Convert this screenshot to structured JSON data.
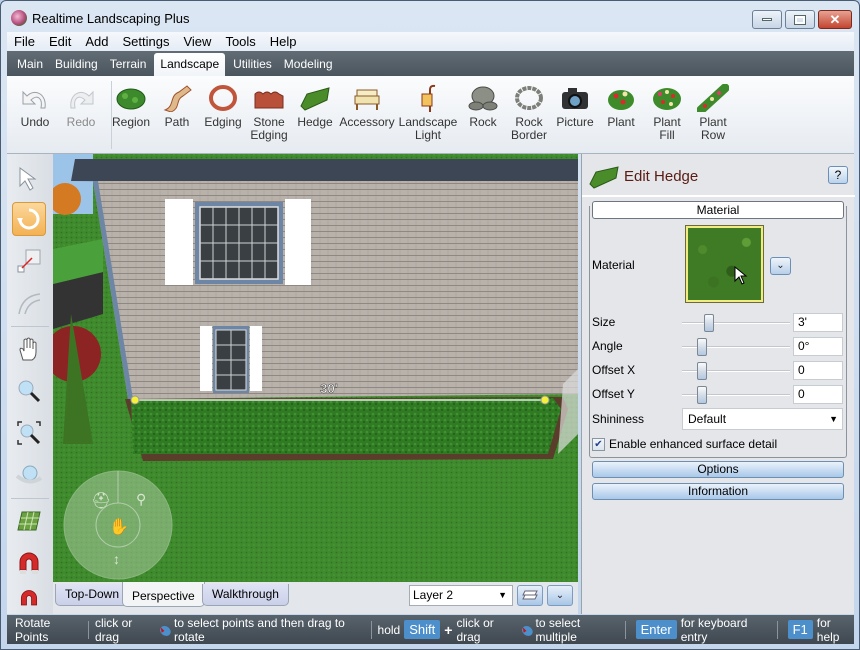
{
  "window": {
    "title": "Realtime Landscaping Plus",
    "controls": {
      "minimize": "minimize",
      "maximize": "maximize",
      "close": "close"
    }
  },
  "menu": [
    "File",
    "Edit",
    "Add",
    "Settings",
    "View",
    "Tools",
    "Help"
  ],
  "tabs": [
    {
      "label": "Main",
      "active": false
    },
    {
      "label": "Building",
      "active": false
    },
    {
      "label": "Terrain",
      "active": false
    },
    {
      "label": "Landscape",
      "active": true
    },
    {
      "label": "Utilities",
      "active": false
    },
    {
      "label": "Modeling",
      "active": false
    }
  ],
  "ribbon": {
    "undo": {
      "label": "Undo",
      "icon": "undo-icon"
    },
    "redo": {
      "label": "Redo",
      "icon": "redo-icon",
      "disabled": true
    },
    "items": [
      {
        "label": "Region",
        "icon": "region-icon"
      },
      {
        "label": "Path",
        "icon": "path-icon"
      },
      {
        "label": "Edging",
        "icon": "edging-icon"
      },
      {
        "label": "Stone Edging",
        "icon": "stone-edging-icon"
      },
      {
        "label": "Hedge",
        "icon": "hedge-icon"
      },
      {
        "label": "Accessory",
        "icon": "accessory-icon"
      },
      {
        "label": "Landscape Light",
        "icon": "landscape-light-icon"
      },
      {
        "label": "Rock",
        "icon": "rock-icon"
      },
      {
        "label": "Rock Border",
        "icon": "rock-border-icon"
      },
      {
        "label": "Picture",
        "icon": "camera-icon"
      },
      {
        "label": "Plant",
        "icon": "plant-icon"
      },
      {
        "label": "Plant Fill",
        "icon": "plant-fill-icon"
      },
      {
        "label": "Plant Row",
        "icon": "plant-row-icon"
      }
    ]
  },
  "left_tools": [
    {
      "name": "select",
      "icon": "arrow-pointer-icon",
      "active": false
    },
    {
      "name": "rotate-points",
      "icon": "rotate-icon",
      "active": true
    },
    {
      "name": "resize",
      "icon": "resize-icon",
      "active": false
    },
    {
      "name": "curve",
      "icon": "curve-icon",
      "active": false,
      "disabled": true
    },
    {
      "name": "pan",
      "icon": "hand-icon",
      "active": false
    },
    {
      "name": "zoom",
      "icon": "magnifier-icon",
      "active": false
    },
    {
      "name": "zoom-extents",
      "icon": "zoom-extents-icon",
      "active": false
    },
    {
      "name": "orbit",
      "icon": "orbit-icon",
      "active": false
    },
    {
      "name": "grid",
      "icon": "grid-icon",
      "active": false
    },
    {
      "name": "snap",
      "icon": "magnet-icon",
      "active": false
    },
    {
      "name": "snap-objects",
      "icon": "magnet-small-icon",
      "active": false
    }
  ],
  "viewport": {
    "measurement": "30'",
    "nav_widget": [
      "orbit-icon",
      "zoom-icon",
      "pan-icon",
      "elevate-icon"
    ]
  },
  "view_tabs": [
    {
      "label": "Top-Down",
      "active": false
    },
    {
      "label": "Perspective",
      "active": true
    },
    {
      "label": "Walkthrough",
      "active": false
    }
  ],
  "layer": {
    "selected": "Layer 2"
  },
  "panel": {
    "title": "Edit Hedge",
    "help": "?",
    "group_title": "Material",
    "material_label": "Material",
    "fields": [
      {
        "label": "Size",
        "value": "3'",
        "slider": 0.22
      },
      {
        "label": "Angle",
        "value": "0°",
        "slider": 0.15
      },
      {
        "label": "Offset X",
        "value": "0",
        "slider": 0.15
      },
      {
        "label": "Offset Y",
        "value": "0",
        "slider": 0.15
      }
    ],
    "shininess": {
      "label": "Shininess",
      "value": "Default"
    },
    "enhanced_detail": {
      "label": "Enable enhanced surface detail",
      "checked": true
    },
    "options_label": "Options",
    "information_label": "Information"
  },
  "status": {
    "mode": "Rotate Points",
    "hint1_a": "click or drag",
    "hint1_b": "to select points and then drag to rotate",
    "hold": "hold",
    "shift_key": "Shift",
    "plus": "+",
    "hint2_a": "click or drag",
    "hint2_b": "to select multiple",
    "enter_key": "Enter",
    "enter_hint": "for keyboard entry",
    "f1_key": "F1",
    "f1_hint": "for help"
  },
  "colors": {
    "accent": "#4c8fcb",
    "active_tool": "#f3b153",
    "panel_title": "#5a1b12",
    "swatch_border": "#f2ec80"
  }
}
